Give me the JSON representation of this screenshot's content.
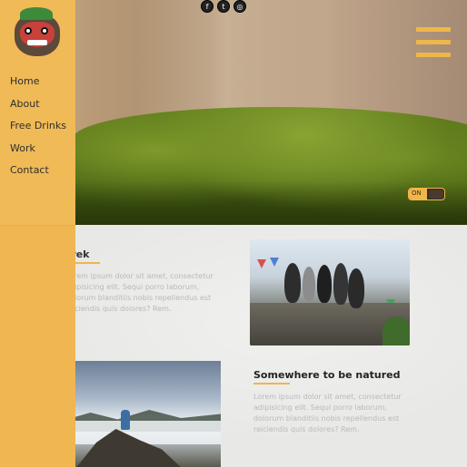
{
  "social": {
    "icons": [
      "facebook-icon",
      "twitter-icon",
      "instagram-icon"
    ]
  },
  "nav": {
    "items": [
      {
        "label": "Home"
      },
      {
        "label": "About"
      },
      {
        "label": "Free Drinks"
      },
      {
        "label": "Work"
      },
      {
        "label": "Contact"
      }
    ]
  },
  "toggle": {
    "label": "ON",
    "state": "on"
  },
  "sections": {
    "trek": {
      "title": "Trek",
      "text": "Lorem ipsum dolor sit amet, consectetur adipisicing elit. Sequi porro laborum, dolorum blanditiis nobis repellendus est reiciendis quis dolores? Rem."
    },
    "nature": {
      "title": "Somewhere to be natured",
      "text": "Lorem ipsum dolor sit amet, consectetur adipisicing elit. Sequi porro laborum, dolorum blanditiis nobis repellendus est reiciendis quis dolores? Rem."
    }
  },
  "colors": {
    "accent": "#f0b64a",
    "sidebar": "#efb651",
    "content_bg": "#e8e8e6",
    "body_text_muted": "#b9b9b9"
  }
}
